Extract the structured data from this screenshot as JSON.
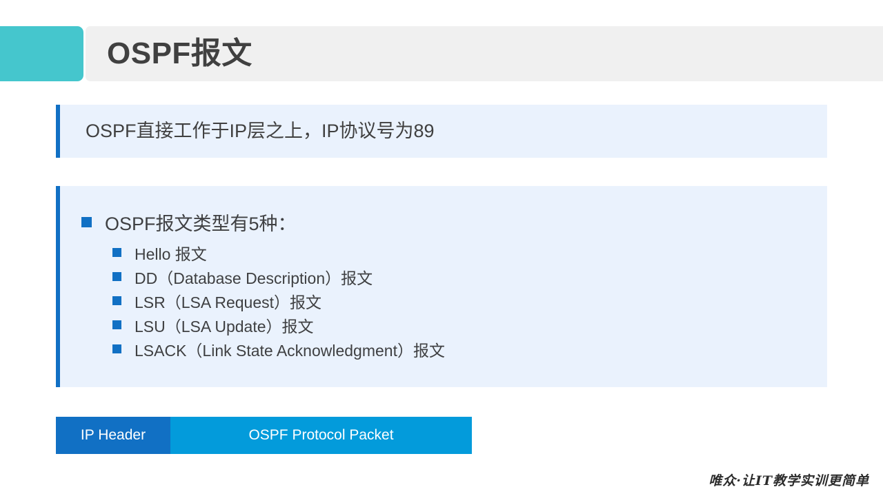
{
  "slide": {
    "title": "OSPF报文",
    "quote": "OSPF直接工作于IP层之上，IP协议号为89",
    "main_bullet": "OSPF报文类型有5种：",
    "sub_bullets": [
      "Hello 报文",
      "DD（Database Description）报文",
      "LSR（LSA Request）报文",
      "LSU（LSA Update）报文",
      "LSACK（Link State Acknowledgment）报文"
    ],
    "packet_diagram": {
      "segments": [
        {
          "label": "IP Header",
          "color": "#1170c4"
        },
        {
          "label": "OSPF Protocol Packet",
          "color": "#039bdb"
        }
      ]
    },
    "footer": "唯众·让IT教学实训更简单",
    "colors": {
      "accent_teal": "#45c6cd",
      "accent_blue": "#1170c4",
      "header_grey": "#f0f0f0",
      "panel_blue": "#eaf2fd",
      "packet_light_blue": "#039bdb",
      "title_text": "#404040"
    }
  }
}
